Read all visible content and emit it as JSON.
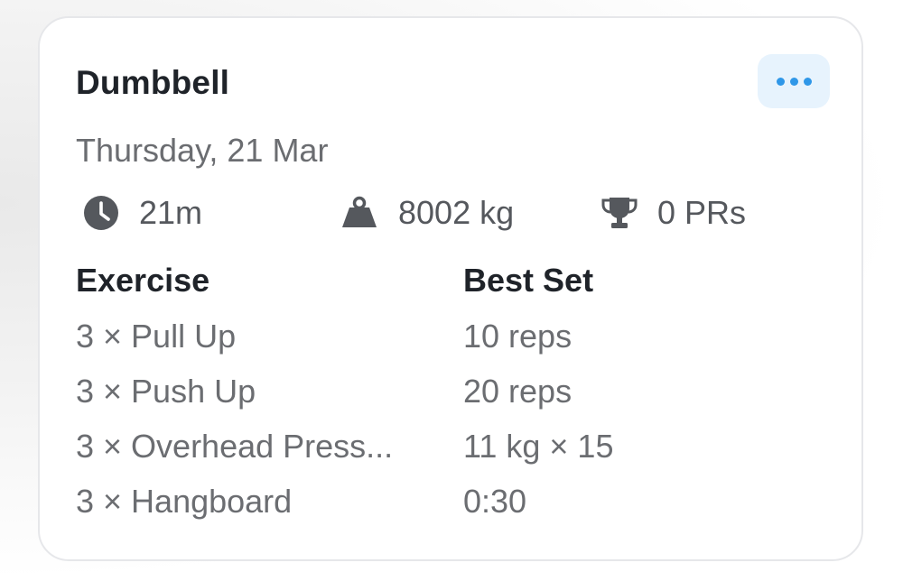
{
  "workout": {
    "title": "Dumbbell",
    "date": "Thursday, 21 Mar",
    "stats": {
      "duration": "21m",
      "volume": "8002 kg",
      "prs": "0 PRs"
    },
    "icons": {
      "duration": "clock-icon",
      "volume": "weight-icon",
      "prs": "trophy-icon",
      "more": "more-dots-icon"
    }
  },
  "table": {
    "headers": {
      "exercise": "Exercise",
      "best_set": "Best Set"
    },
    "rows": [
      {
        "exercise": "3 × Pull Up",
        "best_set": "10 reps"
      },
      {
        "exercise": "3 × Push Up",
        "best_set": "20 reps"
      },
      {
        "exercise": "3 × Overhead Press...",
        "best_set": "11 kg × 15"
      },
      {
        "exercise": "3 × Hangboard",
        "best_set": "0:30"
      }
    ]
  },
  "colors": {
    "accent": "#2f97e8",
    "accent_bg": "#e7f3fd",
    "title_text": "#1f2329",
    "secondary_text": "#6b6d71",
    "icon": "#55585d"
  }
}
